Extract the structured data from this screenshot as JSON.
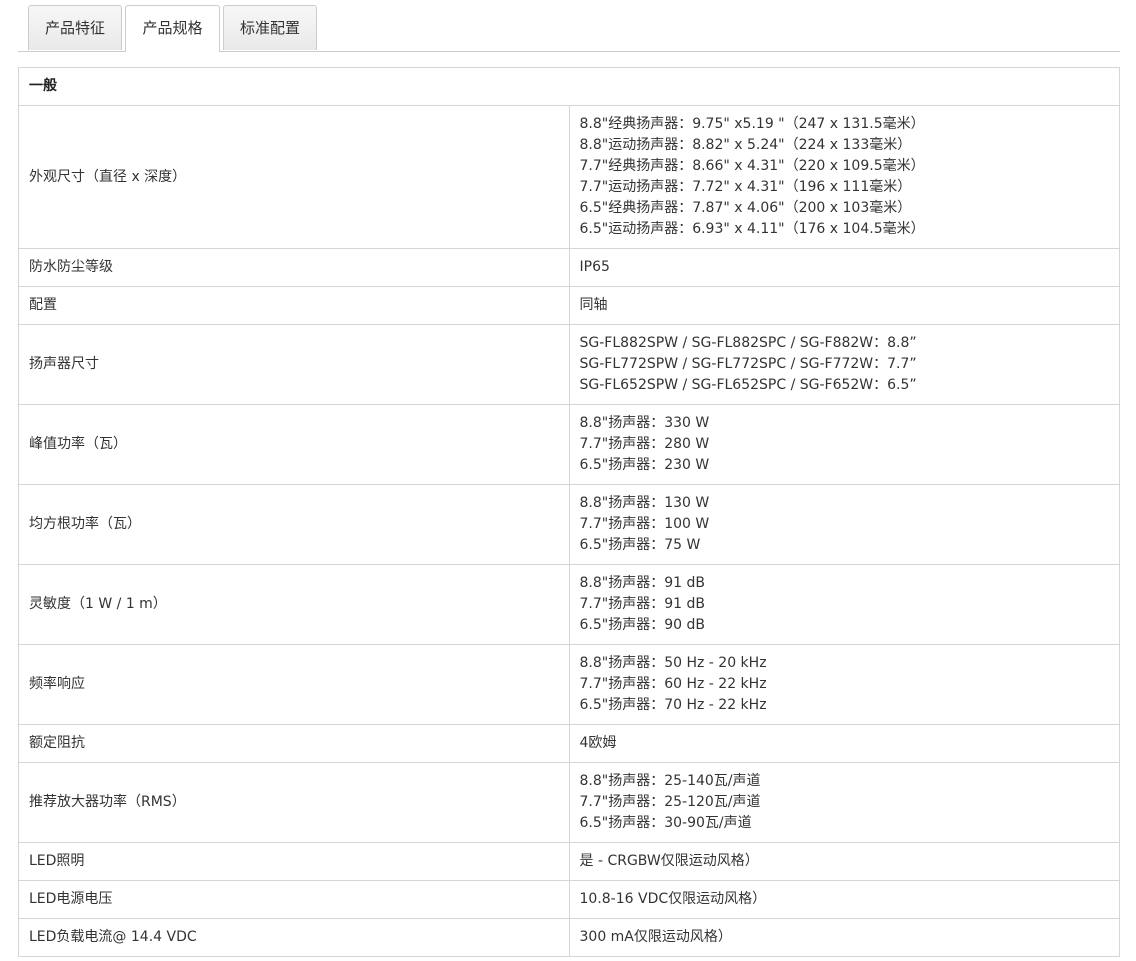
{
  "tabs": [
    {
      "label": "产品特征",
      "active": false
    },
    {
      "label": "产品规格",
      "active": true
    },
    {
      "label": "标准配置",
      "active": false
    }
  ],
  "section_title": "一般",
  "rows": [
    {
      "label": "外观尺寸（直径 x 深度）",
      "values": [
        "8.8\"经典扬声器：9.75\" x5.19 \"（247 x 131.5毫米）",
        "8.8\"运动扬声器：8.82\" x 5.24\"（224 x 133毫米）",
        "7.7\"经典扬声器：8.66\" x 4.31\"（220 x 109.5毫米）",
        "7.7\"运动扬声器：7.72\" x 4.31\"（196 x 111毫米）",
        "6.5\"经典扬声器：7.87\" x 4.06\"（200 x 103毫米）",
        "6.5\"运动扬声器：6.93\" x 4.11\"（176 x 104.5毫米）"
      ]
    },
    {
      "label": "防水防尘等级",
      "values": [
        "IP65"
      ]
    },
    {
      "label": "配置",
      "values": [
        "同轴"
      ]
    },
    {
      "label": "扬声器尺寸",
      "values": [
        "SG-FL882SPW / SG-FL882SPC / SG-F882W：8.8”",
        "SG-FL772SPW / SG-FL772SPC / SG-F772W：7.7”",
        "SG-FL652SPW / SG-FL652SPC / SG-F652W：6.5”"
      ]
    },
    {
      "label": "峰值功率（瓦）",
      "values": [
        "8.8\"扬声器：330 W",
        "7.7\"扬声器：280 W",
        "6.5\"扬声器：230 W"
      ]
    },
    {
      "label": "均方根功率（瓦）",
      "values": [
        "8.8\"扬声器：130 W",
        "7.7\"扬声器：100 W",
        "6.5\"扬声器：75 W"
      ]
    },
    {
      "label": "灵敏度（1 W / 1 m）",
      "values": [
        "8.8\"扬声器：91 dB",
        "7.7\"扬声器：91 dB",
        "6.5\"扬声器：90 dB"
      ]
    },
    {
      "label": "频率响应",
      "values": [
        "8.8\"扬声器：50 Hz - 20 kHz",
        "7.7\"扬声器：60 Hz - 22 kHz",
        "6.5\"扬声器：70 Hz - 22 kHz"
      ]
    },
    {
      "label": "额定阻抗",
      "values": [
        "4欧姆"
      ]
    },
    {
      "label": "推荐放大器功率（RMS）",
      "values": [
        "8.8\"扬声器：25-140瓦/声道",
        "7.7\"扬声器：25-120瓦/声道",
        "6.5\"扬声器：30-90瓦/声道"
      ]
    },
    {
      "label": "LED照明",
      "values": [
        "是 - CRGBW仅限运动风格）"
      ]
    },
    {
      "label": "LED电源电压",
      "values": [
        "10.8-16 VDC仅限运动风格）"
      ]
    },
    {
      "label": "LED负载电流@ 14.4 VDC",
      "values": [
        "300 mA仅限运动风格）"
      ]
    }
  ]
}
